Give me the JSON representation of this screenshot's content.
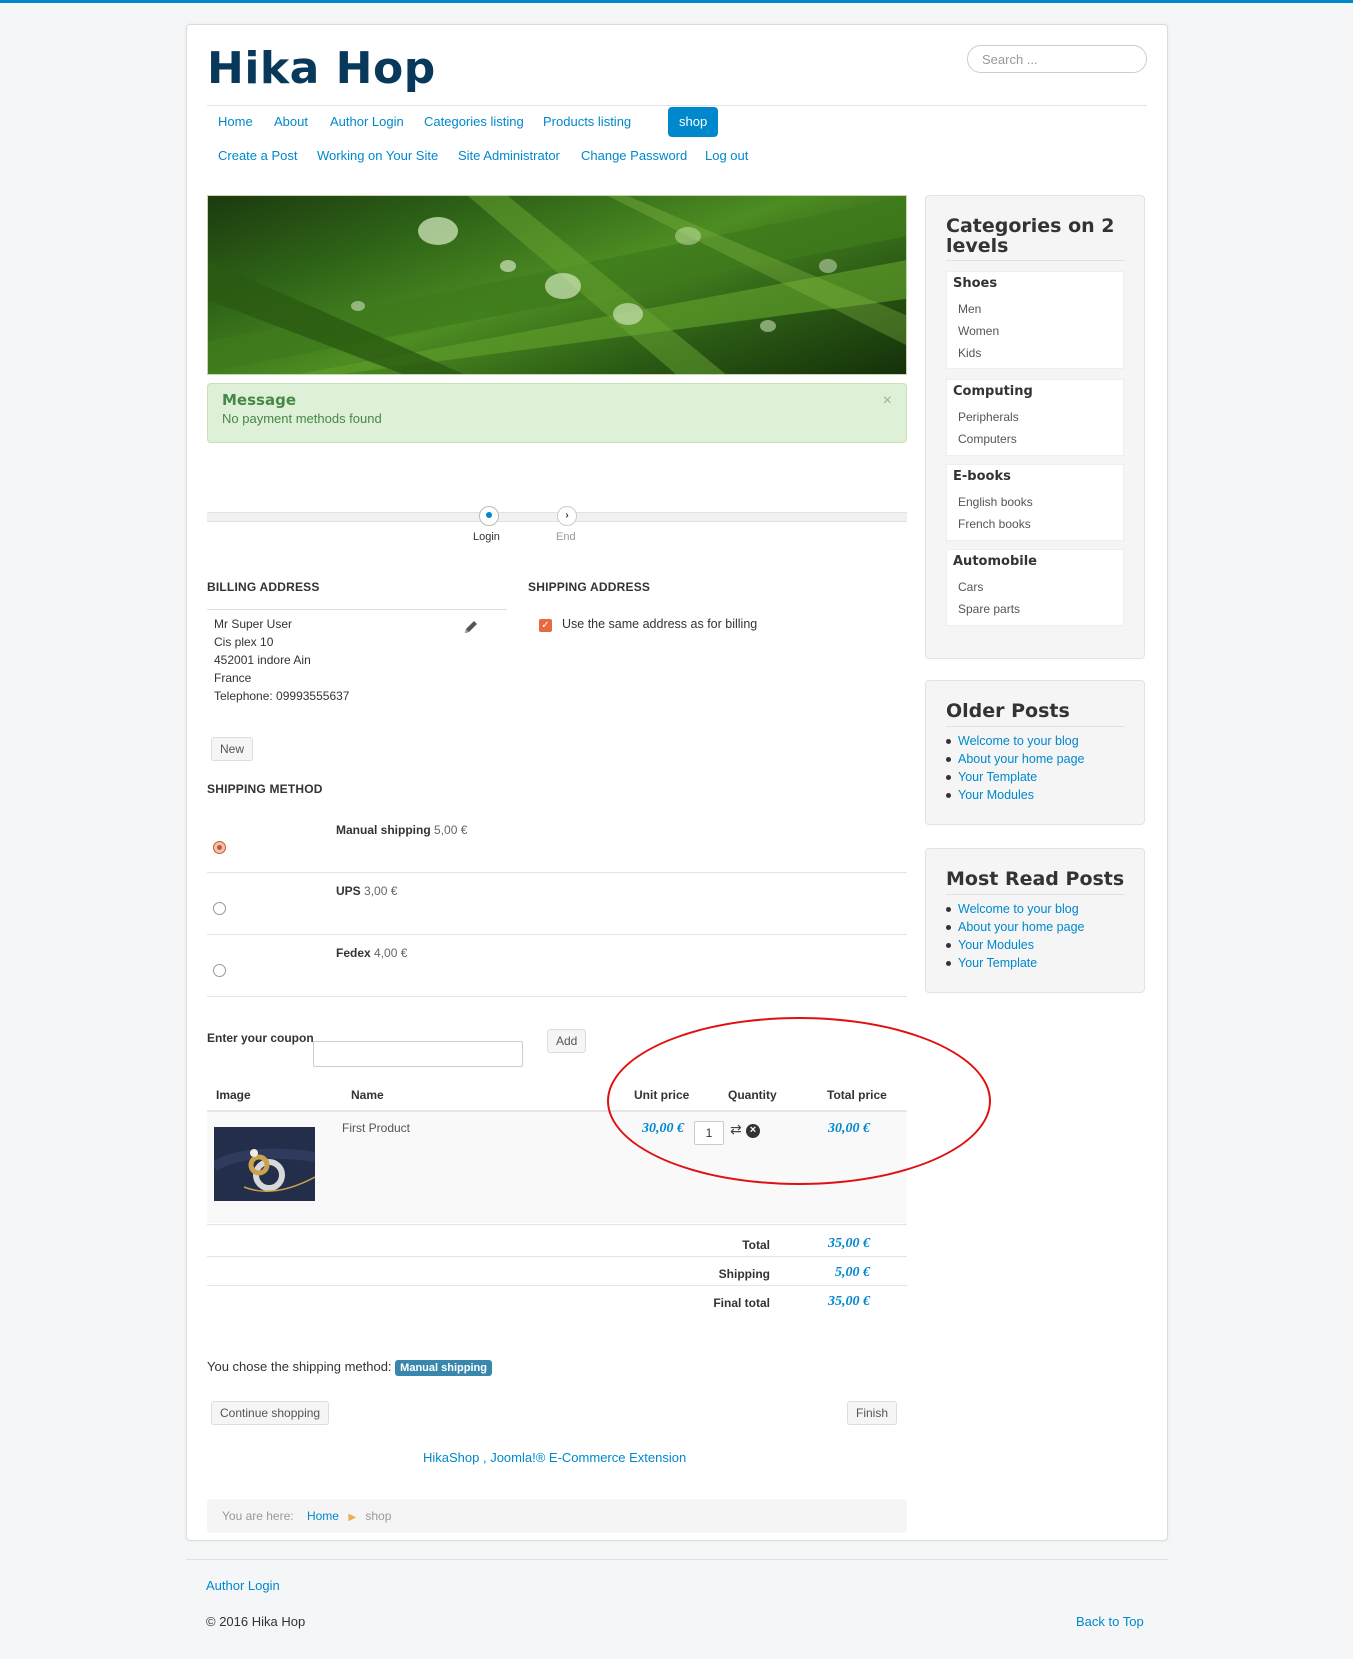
{
  "site": {
    "title": "Hika Hop"
  },
  "search": {
    "placeholder": "Search ..."
  },
  "nav": {
    "row1": [
      "Home",
      "About",
      "Author Login",
      "Categories listing",
      "Products listing",
      "shop"
    ],
    "row2": [
      "Create a Post",
      "Working on Your Site",
      "Site Administrator",
      "Change Password",
      "Log out"
    ],
    "active": "shop"
  },
  "alert": {
    "heading": "Message",
    "text": "No payment methods found",
    "close": "×"
  },
  "wizard": {
    "steps": [
      "Login",
      "End"
    ]
  },
  "billing": {
    "title": "BILLING ADDRESS",
    "lines": [
      "Mr Super User",
      "Cis plex 10",
      "452001 indore Ain",
      "France",
      "Telephone: 09993555637"
    ],
    "new_button": "New"
  },
  "shipping_address": {
    "title": "SHIPPING ADDRESS",
    "same_as_billing_label": "Use the same address as for billing",
    "same_as_billing": true
  },
  "shipping_method": {
    "title": "SHIPPING METHOD",
    "options": [
      {
        "name": "Manual shipping",
        "price": "5,00 €",
        "selected": true
      },
      {
        "name": "UPS",
        "price": "3,00 €",
        "selected": false
      },
      {
        "name": "Fedex",
        "price": "4,00 €",
        "selected": false
      }
    ]
  },
  "coupon": {
    "label": "Enter your coupon",
    "value": "",
    "add_button": "Add"
  },
  "cart": {
    "headers": {
      "image": "Image",
      "name": "Name",
      "unit_price": "Unit price",
      "quantity": "Quantity",
      "total_price": "Total price"
    },
    "rows": [
      {
        "name": "First Product",
        "unit_price": "30,00 €",
        "quantity": "1",
        "total_price": "30,00 €"
      }
    ],
    "totals": [
      {
        "label": "Total",
        "value": "35,00 €"
      },
      {
        "label": "Shipping",
        "value": "5,00 €"
      },
      {
        "label": "Final total",
        "value": "35,00 €"
      }
    ]
  },
  "chosen_shipping": {
    "text": "You chose the shipping method:",
    "badge": "Manual shipping"
  },
  "buttons": {
    "continue": "Continue shopping",
    "finish": "Finish"
  },
  "powered_by": "HikaShop , Joomla!® E-Commerce Extension",
  "breadcrumb": {
    "prefix": "You are here:",
    "home": "Home",
    "current": "shop"
  },
  "sidebar": {
    "categories": {
      "title": "Categories on 2 levels",
      "groups": [
        {
          "name": "Shoes",
          "items": [
            "Men",
            "Women",
            "Kids"
          ]
        },
        {
          "name": "Computing",
          "items": [
            "Peripherals",
            "Computers"
          ]
        },
        {
          "name": "E-books",
          "items": [
            "English books",
            "French books"
          ]
        },
        {
          "name": "Automobile",
          "items": [
            "Cars",
            "Spare parts"
          ]
        }
      ]
    },
    "older_posts": {
      "title": "Older Posts",
      "items": [
        "Welcome to your blog",
        "About your home page",
        "Your Template",
        "Your Modules"
      ]
    },
    "most_read": {
      "title": "Most Read Posts",
      "items": [
        "Welcome to your blog",
        "About your home page",
        "Your Modules",
        "Your Template"
      ]
    }
  },
  "footer": {
    "author_login": "Author Login",
    "copyright": "© 2016 Hika Hop",
    "back_to_top": "Back to Top"
  },
  "colors": {
    "accent": "#0088cc",
    "brand": "#08385a",
    "annotation": "#e01010"
  }
}
